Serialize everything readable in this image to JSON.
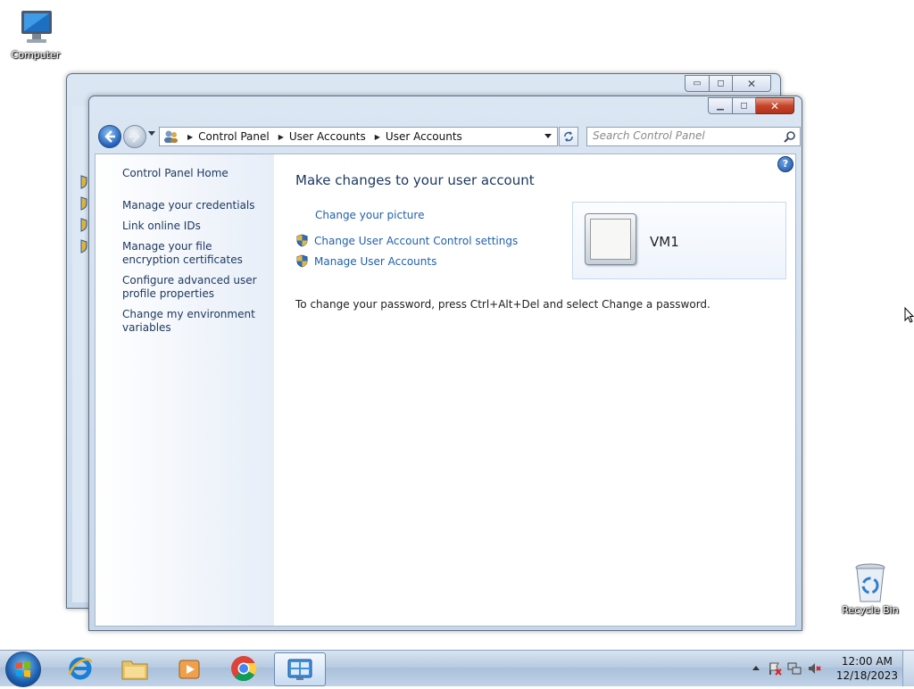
{
  "desktop": {
    "icons": [
      {
        "label": "Computer",
        "icon": "computer-icon"
      },
      {
        "label": "Recycle Bin",
        "icon": "recycle-bin-icon"
      }
    ]
  },
  "back_window": {
    "caption_buttons": {
      "minimize": "▭",
      "maximize": "◻",
      "close": "✕"
    }
  },
  "main_window": {
    "caption_buttons": {
      "minimize": "▁",
      "maximize": "◻",
      "close": "✕"
    },
    "address": {
      "crumbs": [
        "Control Panel",
        "User Accounts",
        "User Accounts"
      ]
    },
    "search": {
      "placeholder": "Search Control Panel"
    },
    "left_links": [
      "Control Panel Home",
      "Manage your credentials",
      "Link online IDs",
      "Manage your file encryption certificates",
      "Configure advanced user profile properties",
      "Change my environment variables"
    ],
    "heading": "Make changes to your user account",
    "tasks": [
      {
        "label": "Change your picture",
        "shield": false
      },
      {
        "label": "Change User Account Control settings",
        "shield": true
      },
      {
        "label": "Manage User Accounts",
        "shield": true
      }
    ],
    "account": {
      "name": "VM1"
    },
    "password_note": "To change your password, press Ctrl+Alt+Del and select Change a password.",
    "help_glyph": "?"
  },
  "taskbar": {
    "apps": [
      "internet-explorer-icon",
      "windows-explorer-icon",
      "media-player-icon",
      "chrome-icon",
      "control-panel-icon"
    ],
    "clock": {
      "time": "12:00 AM",
      "date": "12/18/2023"
    }
  },
  "colors": {
    "link": "#2161ad",
    "heading": "#1e3960",
    "close_button": "#c7442a"
  }
}
